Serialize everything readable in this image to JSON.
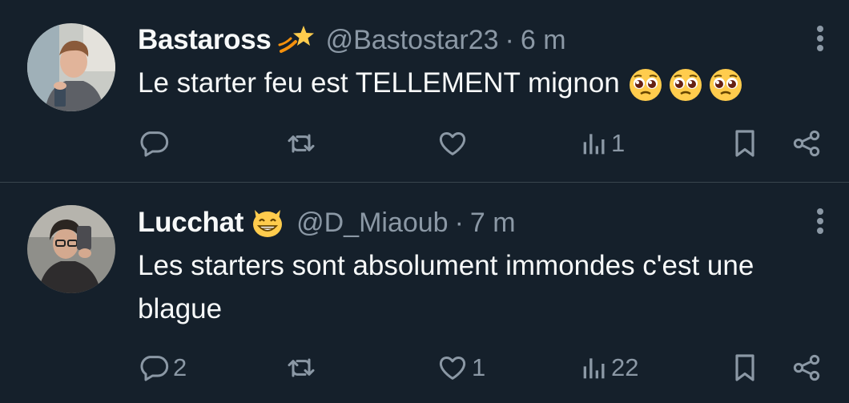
{
  "colors": {
    "background": "#15202b",
    "text_primary": "#f7f9f9",
    "text_secondary": "#8b98a5",
    "divider": "#38444d"
  },
  "tweets": [
    {
      "display_name": "Bastaross",
      "badge_icon": "dizzy-star-emoji",
      "handle": "@Bastostar23",
      "separator": "·",
      "time": "6 m",
      "text": "Le starter feu est TELLEMENT mignon",
      "trailing_emojis": [
        "pleading-face-emoji",
        "pleading-face-emoji",
        "pleading-face-emoji"
      ],
      "actions": {
        "reply": "",
        "retweet": "",
        "like": "",
        "views": "1"
      }
    },
    {
      "display_name": "Lucchat",
      "badge_icon": "grinning-cat-emoji",
      "handle": "@D_Miaoub",
      "separator": "·",
      "time": "7 m",
      "text": "Les starters sont absolument immondes c'est une blague",
      "trailing_emojis": [],
      "actions": {
        "reply": "2",
        "retweet": "",
        "like": "1",
        "views": "22"
      }
    }
  ]
}
